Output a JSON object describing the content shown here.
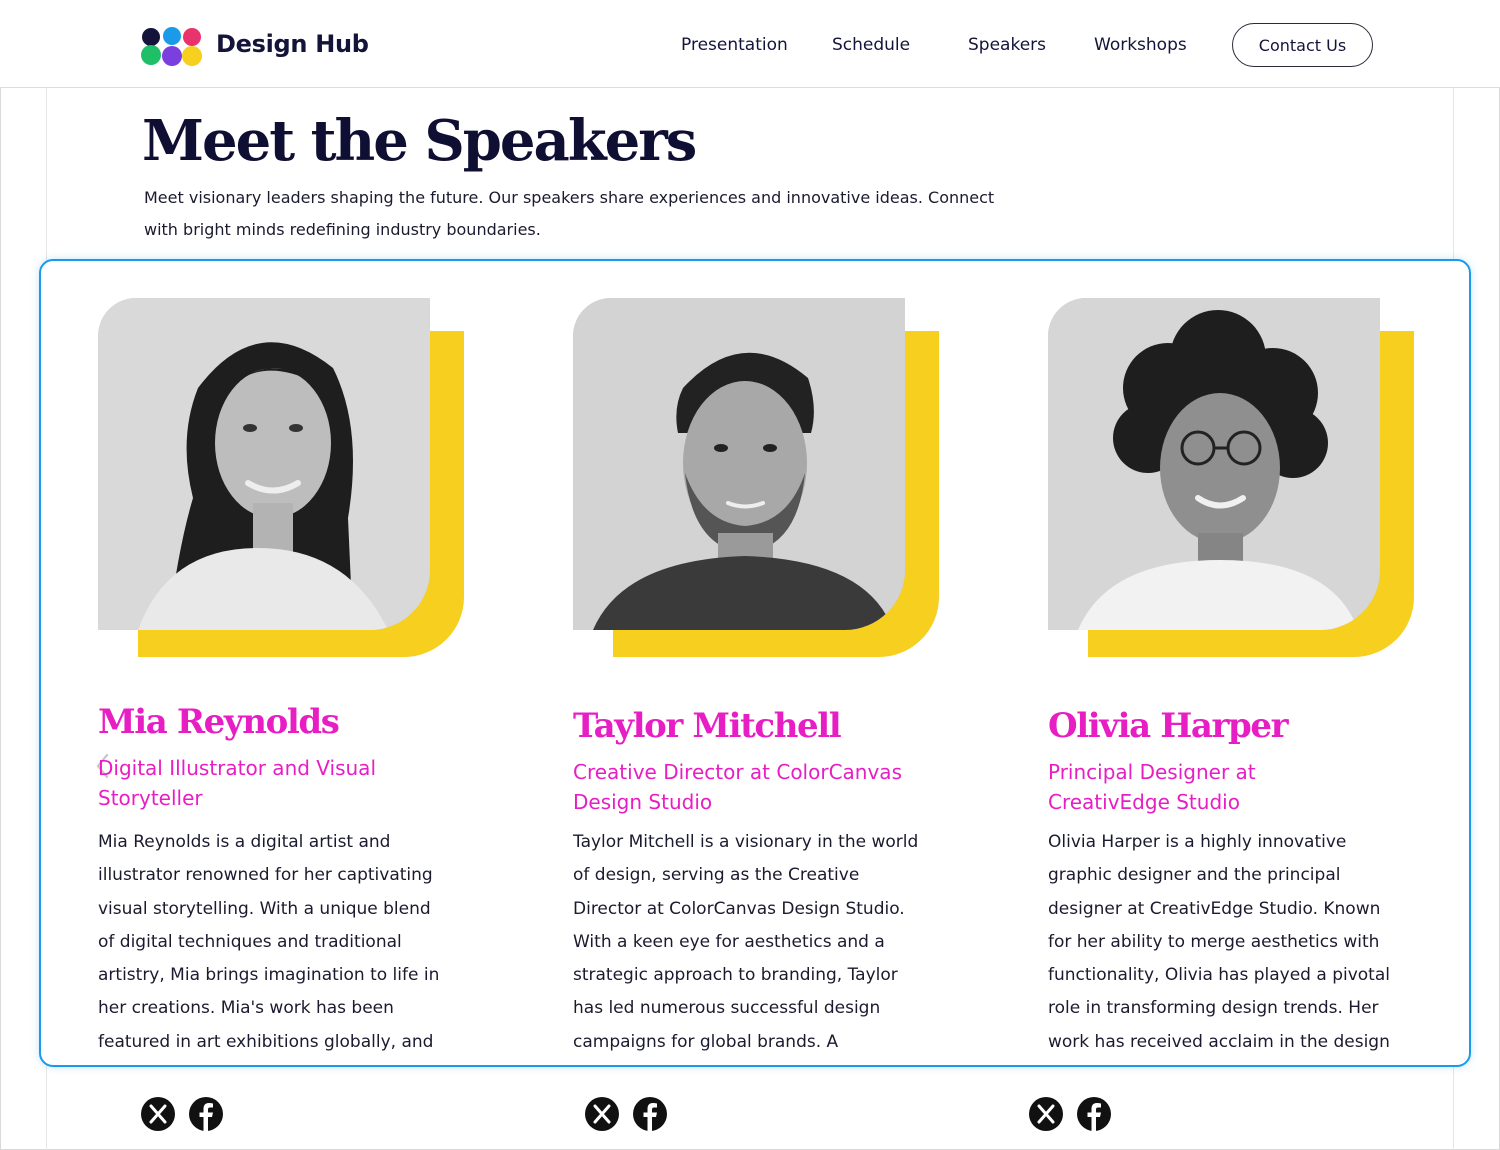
{
  "header": {
    "brand": "Design Hub",
    "nav": [
      "Presentation",
      "Schedule",
      "Speakers",
      "Workshops"
    ],
    "contact_label": "Contact Us"
  },
  "hero": {
    "title": "Meet the Speakers",
    "intro_line1": "Meet visionary leaders shaping the future. Our speakers share experiences and innovative ideas. Connect",
    "intro_line2": "with bright minds redefining industry boundaries."
  },
  "colors": {
    "accent_pink": "#e81ec5",
    "accent_yellow": "#f6cf1f",
    "focus_blue": "#1a9ae8",
    "ink": "#0f0f33"
  },
  "speakers": [
    {
      "name": "Mia Reynolds",
      "role": "Digital Illustrator and Visual Storyteller",
      "bio_lines": [
        "Mia Reynolds is a digital artist and",
        "illustrator renowned for her captivating",
        "visual storytelling. With a unique blend",
        "of digital techniques and traditional",
        "artistry, Mia brings imagination to life in",
        "her creations. Mia's work has been",
        "featured in art exhibitions globally, and"
      ],
      "photo_icon": "portrait-woman-long-hair"
    },
    {
      "name": "Taylor Mitchell",
      "role": "Creative Director at ColorCanvas Design Studio",
      "bio_lines": [
        "Taylor Mitchell is a visionary in the world",
        "of design, serving as the Creative",
        "Director at ColorCanvas Design Studio.",
        "With a keen eye for aesthetics and a",
        "strategic approach to branding, Taylor",
        "has led numerous successful design",
        "campaigns for global brands. A"
      ],
      "photo_icon": "portrait-man-beard"
    },
    {
      "name": "Olivia Harper",
      "role": "Principal Designer at CreativEdge Studio",
      "bio_lines": [
        "Olivia Harper is a highly innovative",
        "graphic designer and the principal",
        "designer at CreativEdge Studio. Known",
        "for her ability to merge aesthetics with",
        "functionality, Olivia has played a pivotal",
        "role in transforming design trends. Her",
        "work has received acclaim in the design"
      ],
      "photo_icon": "portrait-woman-curly-hair"
    }
  ],
  "social_icons": [
    "x-icon",
    "facebook-icon"
  ]
}
